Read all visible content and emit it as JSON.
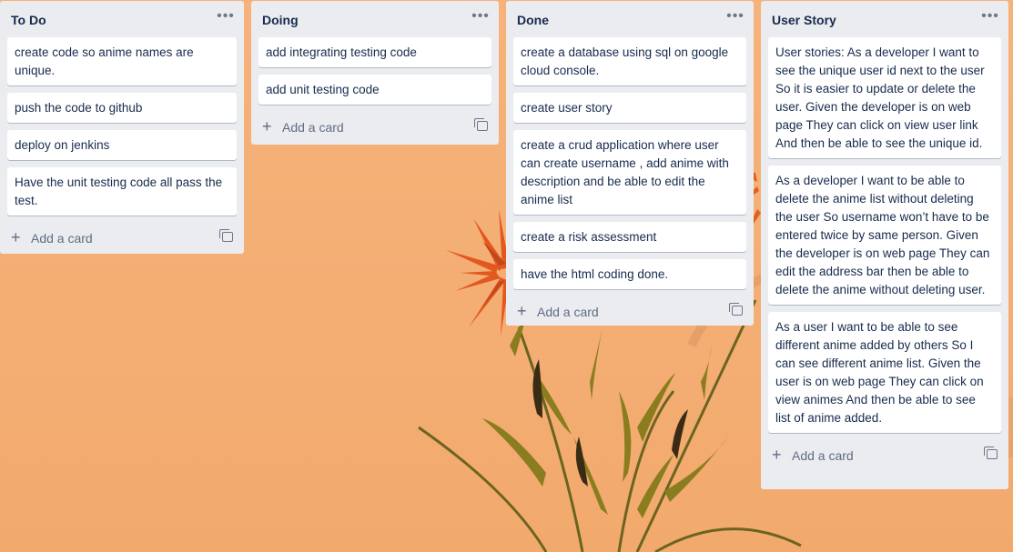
{
  "lists": [
    {
      "title": "To Do",
      "cards": [
        "create code so anime names are unique.",
        "push the code to github",
        "deploy on jenkins",
        "Have the unit testing code all pass the test."
      ],
      "add_label": "Add a card"
    },
    {
      "title": "Doing",
      "cards": [
        "add integrating testing code",
        "add unit testing code"
      ],
      "add_label": "Add a card"
    },
    {
      "title": "Done",
      "cards": [
        "create a database using sql on google cloud console.",
        "create user story",
        "create a crud application where user can create username , add anime with description and be able to edit the anime list",
        "create a risk assessment",
        "have the html coding done."
      ],
      "add_label": "Add a card"
    },
    {
      "title": "User Story",
      "cards": [
        "User stories: As a developer I want to see the unique user id next to the user So it is easier to update or delete the user. Given the developer is on web page They can click on view user link And then be able to see the unique id.",
        "As a developer I want to be able to delete the anime list without deleting the user So username won’t have to be entered twice by same person. Given the developer is on web page They can edit the address bar then be able to delete the anime without deleting user.",
        "As a user I want to be able to see different anime added by others So I can see different anime list. Given the user is on web page They can click on view animes And then be able to see list of anime added."
      ],
      "add_label": "Add a card"
    }
  ],
  "icons": {
    "menu": "more-horizontal-icon",
    "add": "plus-icon",
    "template": "card-template-icon"
  },
  "colors": {
    "background": "#f4ae74",
    "list_bg": "#ebecf0",
    "card_bg": "#ffffff",
    "text": "#172b4d",
    "muted": "#5e6c84"
  }
}
